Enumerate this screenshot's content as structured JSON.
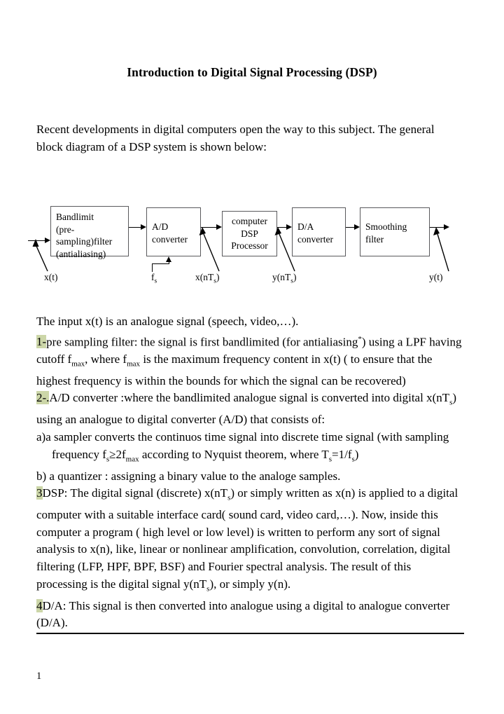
{
  "document": {
    "title": "Introduction to Digital Signal Processing (DSP)",
    "intro": "Recent developments in digital computers open the way to this subject. The general block diagram of a DSP system is shown below:",
    "page_number": "1"
  },
  "diagram": {
    "blocks": [
      {
        "id": "bandlimit",
        "lines": [
          "Bandlimit",
          "(pre-",
          "sampling)filter",
          "(antialiasing)"
        ]
      },
      {
        "id": "ad-converter",
        "lines": [
          "A/D",
          "converter"
        ]
      },
      {
        "id": "computer-dsp",
        "lines": [
          "computer",
          "DSP",
          "Processor"
        ]
      },
      {
        "id": "da-converter",
        "lines": [
          "D/A",
          "converter"
        ]
      },
      {
        "id": "smoothing-filter",
        "lines": [
          "Smoothing",
          "filter"
        ]
      }
    ],
    "signal_labels": {
      "input": "x(t)",
      "sampling_freq": "f",
      "sampling_freq_sub": "s",
      "digital_in": "x(nT",
      "digital_in_sub": "s",
      "digital_in_end": ")",
      "digital_out": "y(nT",
      "digital_out_sub": "s",
      "digital_out_end": ")",
      "output": "y(t)"
    }
  },
  "body": {
    "line_input": "The input x(t) is an analogue signal (speech, video,…).",
    "item1": {
      "marker": "1-",
      "t1": "pre sampling filter: the signal is first bandlimited (for antialiasing",
      "sup": "*",
      "t2": ") using a LPF having cutoff f",
      "sub1": "max",
      "t3": ", where f",
      "sub2": "max",
      "t4": " is the maximum frequency content in x(t) ( to ensure that the highest frequency is within the bounds for which the signal can be recovered)"
    },
    "item2": {
      "marker": "2-.",
      "t1": "A/D converter :where the bandlimited analogue signal is  converted into digital x(nT",
      "sub1": "s",
      "t2": ") using an analogue to digital converter (A/D) that consists of:"
    },
    "item2a": {
      "marker": "a)",
      "t1": "a sampler converts the continuos time signal into discrete time signal (with sampling frequency f",
      "sub1": "s",
      "t2": "≥2f",
      "sub2": "max",
      "t3": " according to Nyquist theorem, where T",
      "sub3": "s",
      "t4": "=1/f",
      "sub4": "s",
      "t5": ")"
    },
    "item2b": {
      "marker": "b)",
      "t1": "a quantizer : assigning a binary value to the analoge samples."
    },
    "item3": {
      "marker": "3",
      "t1": "DSP: The digital signal (discrete) x(nT",
      "sub1": "s",
      "t2": ") or simply written as x(n) is applied to a digital computer with a suitable interface card( sound card, video card,…). Now, inside this computer a program ( high level or low level) is written to perform any sort of signal analysis to x(n), like, linear or nonlinear amplification, convolution, correlation, digital filtering (LFP, HPF, BPF, BSF) and Fourier spectral analysis. The result of this processing is the digital signal y(nT",
      "sub2": "s",
      "t3": "), or simply y(n)."
    },
    "item4": {
      "marker": "4",
      "t1": "D/A: This signal is then converted into analogue using a digital to analogue converter (D/A)."
    }
  },
  "colors": {
    "highlight": "#ccd6a8",
    "text": "#000000",
    "box_border": "#59595c",
    "page_background": "#ffffff"
  }
}
